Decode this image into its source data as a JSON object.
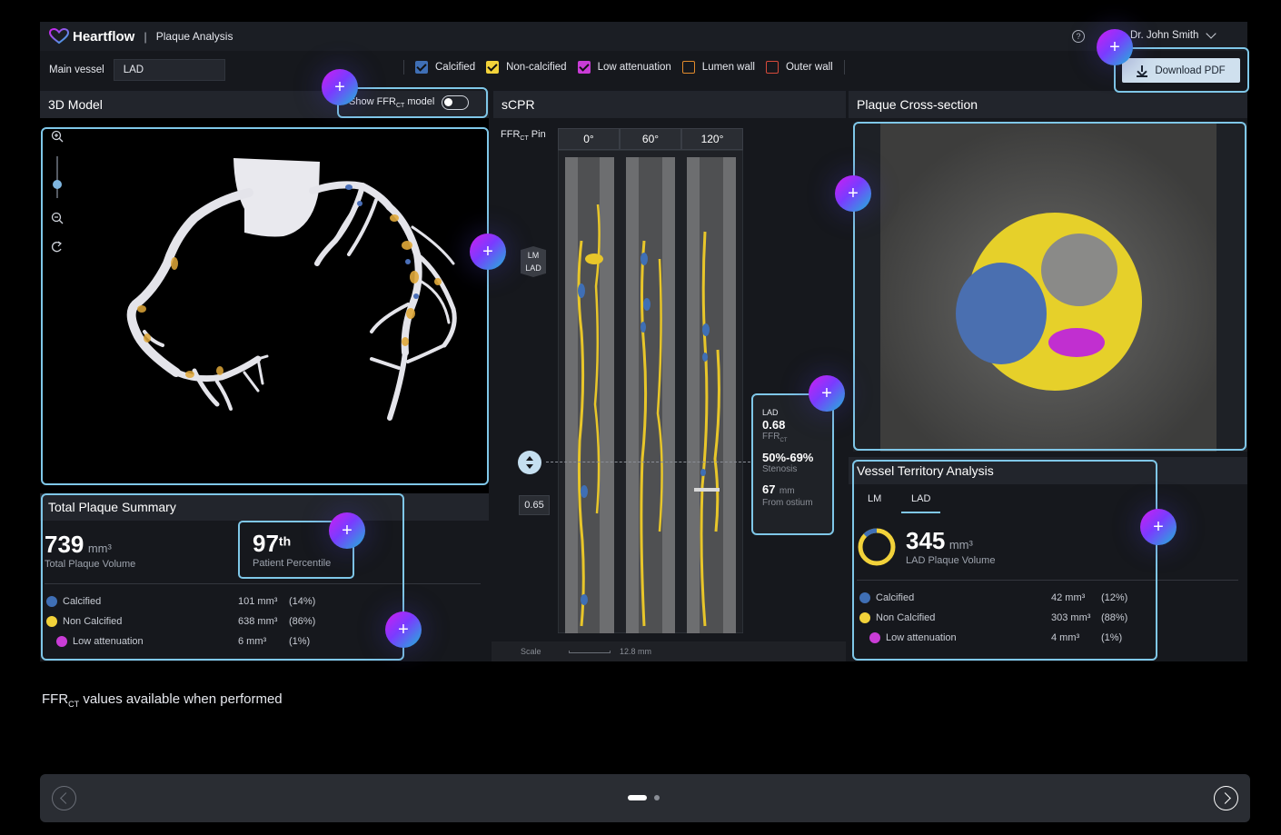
{
  "header": {
    "brand": "Heartflow",
    "section": "Plaque Analysis",
    "user": "Dr. John Smith",
    "help_icon": "question-circle-icon"
  },
  "toolbar": {
    "main_vessel_label": "Main vessel",
    "main_vessel_value": "LAD",
    "legend": [
      {
        "label": "Calcified",
        "color": "#3f6fb5",
        "checked": true
      },
      {
        "label": "Non-calcified",
        "color": "#f2d23a",
        "checked": true
      },
      {
        "label": "Low attenuation",
        "color": "#c93cd6",
        "checked": true
      },
      {
        "label": "Lumen wall",
        "color": "#e08a2b",
        "checked": false
      },
      {
        "label": "Outer wall",
        "color": "#d64a3a",
        "checked": false
      }
    ],
    "download_label": "Download PDF"
  },
  "model3d": {
    "title": "3D Model",
    "toggle_label_pre": "Show FFR",
    "toggle_label_sub": "CT",
    "toggle_label_post": " model"
  },
  "scpr": {
    "title": "sCPR",
    "pin_label_pre": "FFR",
    "pin_label_sub": "CT",
    "pin_label_post": " Pin",
    "angles": [
      "0°",
      "60°",
      "120°"
    ],
    "markers": [
      "LM",
      "LAD"
    ],
    "pin_value": "0.65",
    "scale_label": "Scale",
    "scale_value": "12.8 mm",
    "tooltip": {
      "vessel": "LAD",
      "ffr_value": "0.68",
      "ffr_label_pre": "FFR",
      "ffr_label_sub": "CT",
      "stenosis_value": "50%-69%",
      "stenosis_label": "Stenosis",
      "distance_value": "67",
      "distance_unit": "mm",
      "distance_label": "From ostium"
    }
  },
  "cross_section": {
    "title": "Plaque Cross-section"
  },
  "total_plaque": {
    "title": "Total Plaque Summary",
    "volume_value": "739",
    "volume_unit": "mm³",
    "volume_label": "Total Plaque Volume",
    "percentile_value": "97",
    "percentile_suffix": "th",
    "percentile_label": "Patient Percentile",
    "rows": [
      {
        "label": "Calcified",
        "value": "101 mm³",
        "pct": "(14%)",
        "color": "#3f6fb5"
      },
      {
        "label": "Non Calcified",
        "value": "638 mm³",
        "pct": "(86%)",
        "color": "#f2d23a"
      },
      {
        "label": "Low attenuation",
        "value": "6 mm³",
        "pct": "(1%)",
        "color": "#c93cd6"
      }
    ]
  },
  "vessel_territory": {
    "title": "Vessel Territory Analysis",
    "tabs": [
      "LM",
      "LAD"
    ],
    "active_tab": "LAD",
    "volume_value": "345",
    "volume_unit": "mm³",
    "volume_label": "LAD Plaque Volume",
    "rows": [
      {
        "label": "Calcified",
        "value": "42 mm³",
        "pct": "(12%)",
        "color": "#3f6fb5"
      },
      {
        "label": "Non Calcified",
        "value": "303 mm³",
        "pct": "(88%)",
        "color": "#f2d23a"
      },
      {
        "label": "Low attenuation",
        "value": "4 mm³",
        "pct": "(1%)",
        "color": "#c93cd6"
      }
    ]
  },
  "caption": {
    "pre": "FFR",
    "sub": "CT",
    "post": " values available when performed"
  },
  "pager": {
    "current": 1,
    "total": 2
  }
}
